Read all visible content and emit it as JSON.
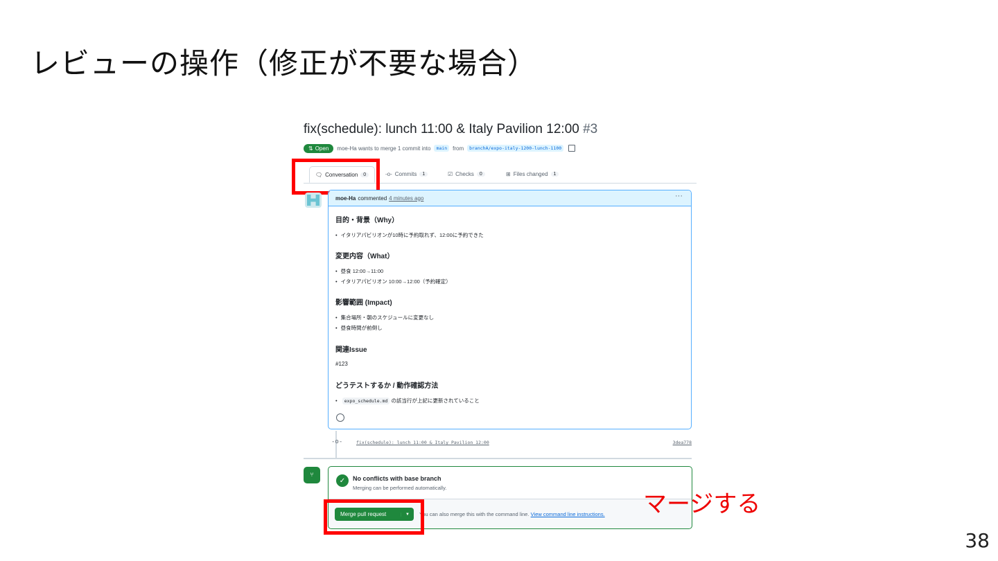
{
  "slide": {
    "title": "レビューの操作（修正が不要な場合）",
    "page_number": "38",
    "annotation": "マージする"
  },
  "pr": {
    "title": "fix(schedule): lunch 11:00 & Italy Pavilion 12:00",
    "number": "#3",
    "status": "Open",
    "meta_prefix": "moe-Ha wants to merge 1 commit into",
    "base_branch": "main",
    "meta_from": "from",
    "head_branch": "branchA/expo-italy-1200-lunch-1100"
  },
  "tabs": [
    {
      "label": "Conversation",
      "count": "0",
      "icon": "conversation-icon"
    },
    {
      "label": "Commits",
      "count": "1",
      "icon": "commit-icon"
    },
    {
      "label": "Checks",
      "count": "0",
      "icon": "checks-icon"
    },
    {
      "label": "Files changed",
      "count": "1",
      "icon": "file-diff-icon"
    }
  ],
  "comment": {
    "author": "moe-Ha",
    "action": "commented",
    "time": "4 minutes ago",
    "sections": {
      "why_heading": "目的・背景（Why）",
      "why_item": "イタリアパビリオンが10時に予約取れず、12:00に予約できた",
      "what_heading": "変更内容（What）",
      "what_item1": "昼食 12:00→11:00",
      "what_item2": "イタリアパビリオン 10:00→12:00（予約確定）",
      "impact_heading": "影響範囲 (Impact)",
      "impact_item1": "集合場所・朝のスケジュールに変更なし",
      "impact_item2": "昼食時間が前倒し",
      "issue_heading": "関連Issue",
      "issue_ref": "#123",
      "test_heading": "どうテストするか / 動作確認方法",
      "test_code": "expo_schedule.md",
      "test_text": "の該当行が上記に更新されていること"
    }
  },
  "commit": {
    "message": "fix(schedule): lunch 11:00 & Italy Pavilion 12:00",
    "sha": "3dea778"
  },
  "merge": {
    "status_title": "No conflicts with base branch",
    "status_sub": "Merging can be performed automatically.",
    "button_label": "Merge pull request",
    "cmd_text": "You can also merge this with the command line.",
    "cmd_link": "View command line instructions."
  },
  "colors": {
    "highlight": "#ff0000",
    "success": "#1f883d",
    "link": "#0969da"
  }
}
